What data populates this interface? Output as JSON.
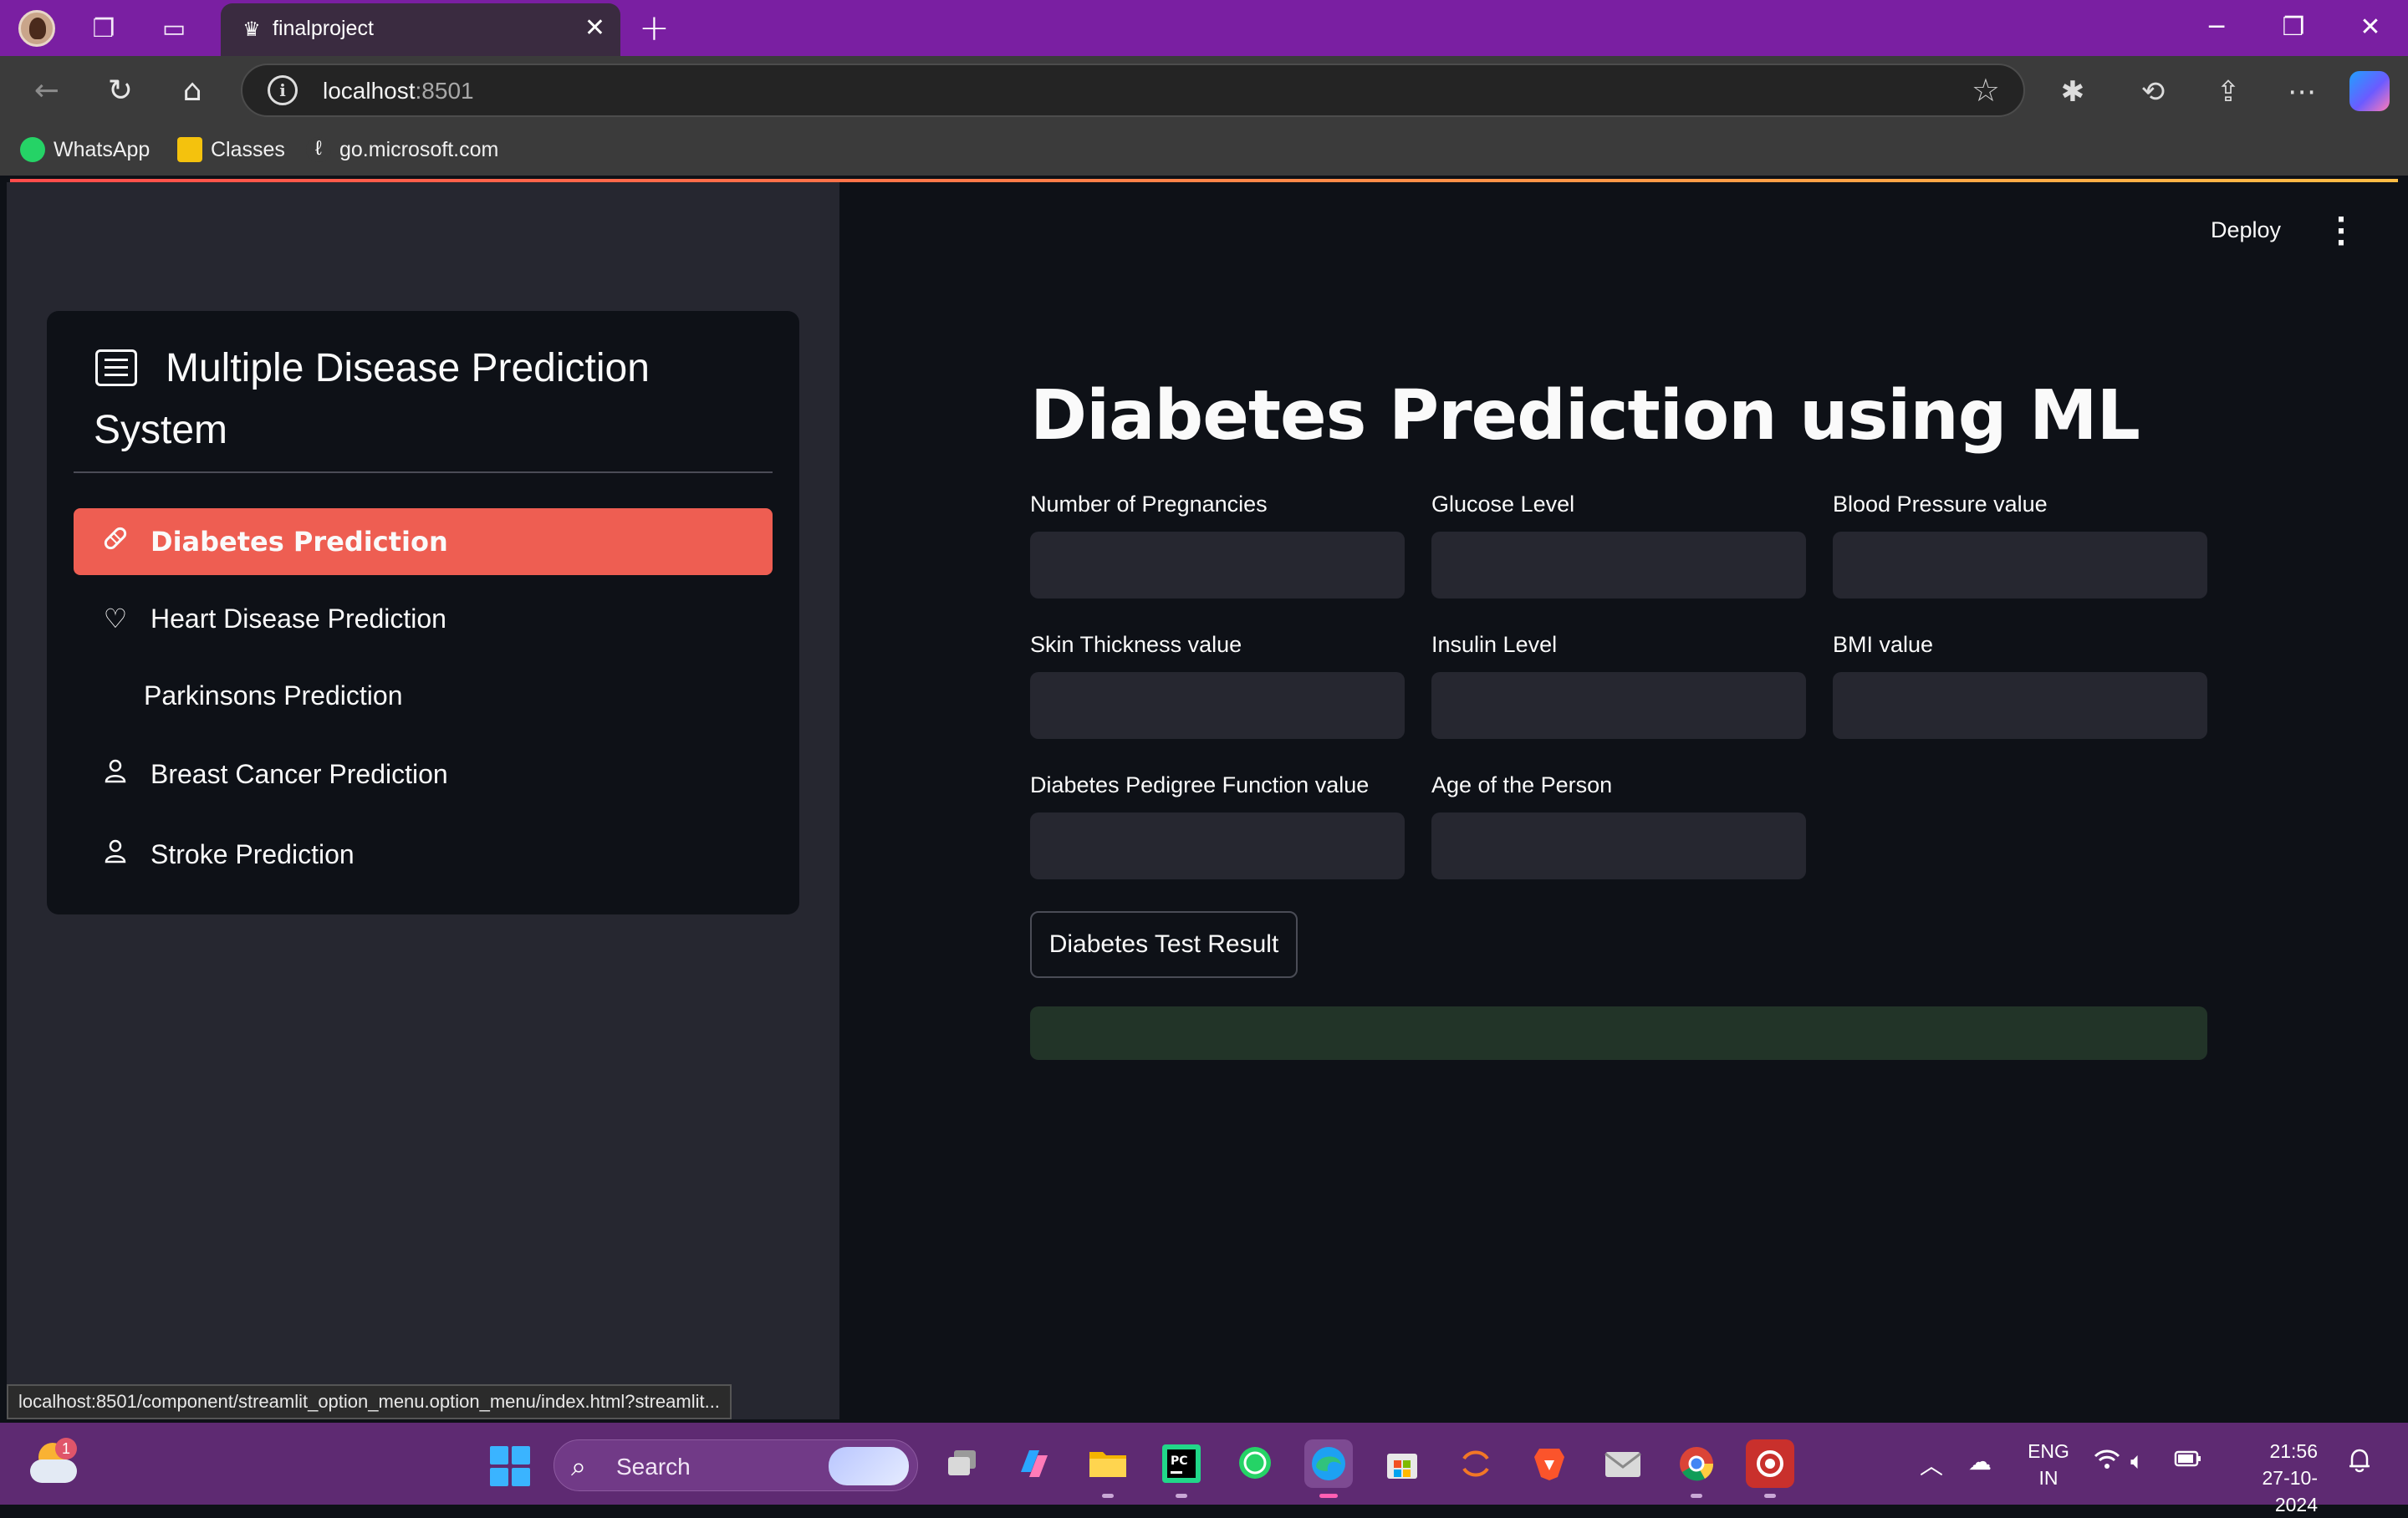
{
  "browser": {
    "tab_title": "finalproject",
    "address_host": "localhost",
    "address_port": ":8501",
    "bookmarks": [
      "WhatsApp",
      "Classes",
      "go.microsoft.com"
    ],
    "status_url": "localhost:8501/component/streamlit_option_menu.option_menu/index.html?streamlit..."
  },
  "sidebar": {
    "menu_title": "Multiple Disease Prediction System",
    "items": [
      {
        "label": "Diabetes Prediction",
        "icon": "bandage-icon",
        "active": true
      },
      {
        "label": "Heart Disease Prediction",
        "icon": "heart-icon",
        "active": false
      },
      {
        "label": "Parkinsons Prediction",
        "icon": "",
        "active": false
      },
      {
        "label": "Breast Cancer Prediction",
        "icon": "person-icon",
        "active": false
      },
      {
        "label": "Stroke Prediction",
        "icon": "person-icon",
        "active": false
      }
    ]
  },
  "header": {
    "deploy_label": "Deploy"
  },
  "main": {
    "title": "Diabetes Prediction using ML",
    "fields": [
      {
        "label": "Number of Pregnancies",
        "value": ""
      },
      {
        "label": "Glucose Level",
        "value": ""
      },
      {
        "label": "Blood Pressure value",
        "value": ""
      },
      {
        "label": "Skin Thickness value",
        "value": ""
      },
      {
        "label": "Insulin Level",
        "value": ""
      },
      {
        "label": "BMI value",
        "value": ""
      },
      {
        "label": "Diabetes Pedigree Function value",
        "value": ""
      },
      {
        "label": "Age of the Person",
        "value": ""
      }
    ],
    "submit_label": "Diabetes Test Result",
    "result_text": ""
  },
  "taskbar": {
    "weather_badge": "1",
    "search_placeholder": "Search",
    "lang_line1": "ENG",
    "lang_line2": "IN",
    "time": "21:56",
    "date": "27-10-2024"
  },
  "colors": {
    "accent": "#ee5e52",
    "titlebar": "#7a1fa2",
    "app_bg": "#0e1117",
    "sidebar_bg": "#262730",
    "success_bg": "#223428"
  }
}
